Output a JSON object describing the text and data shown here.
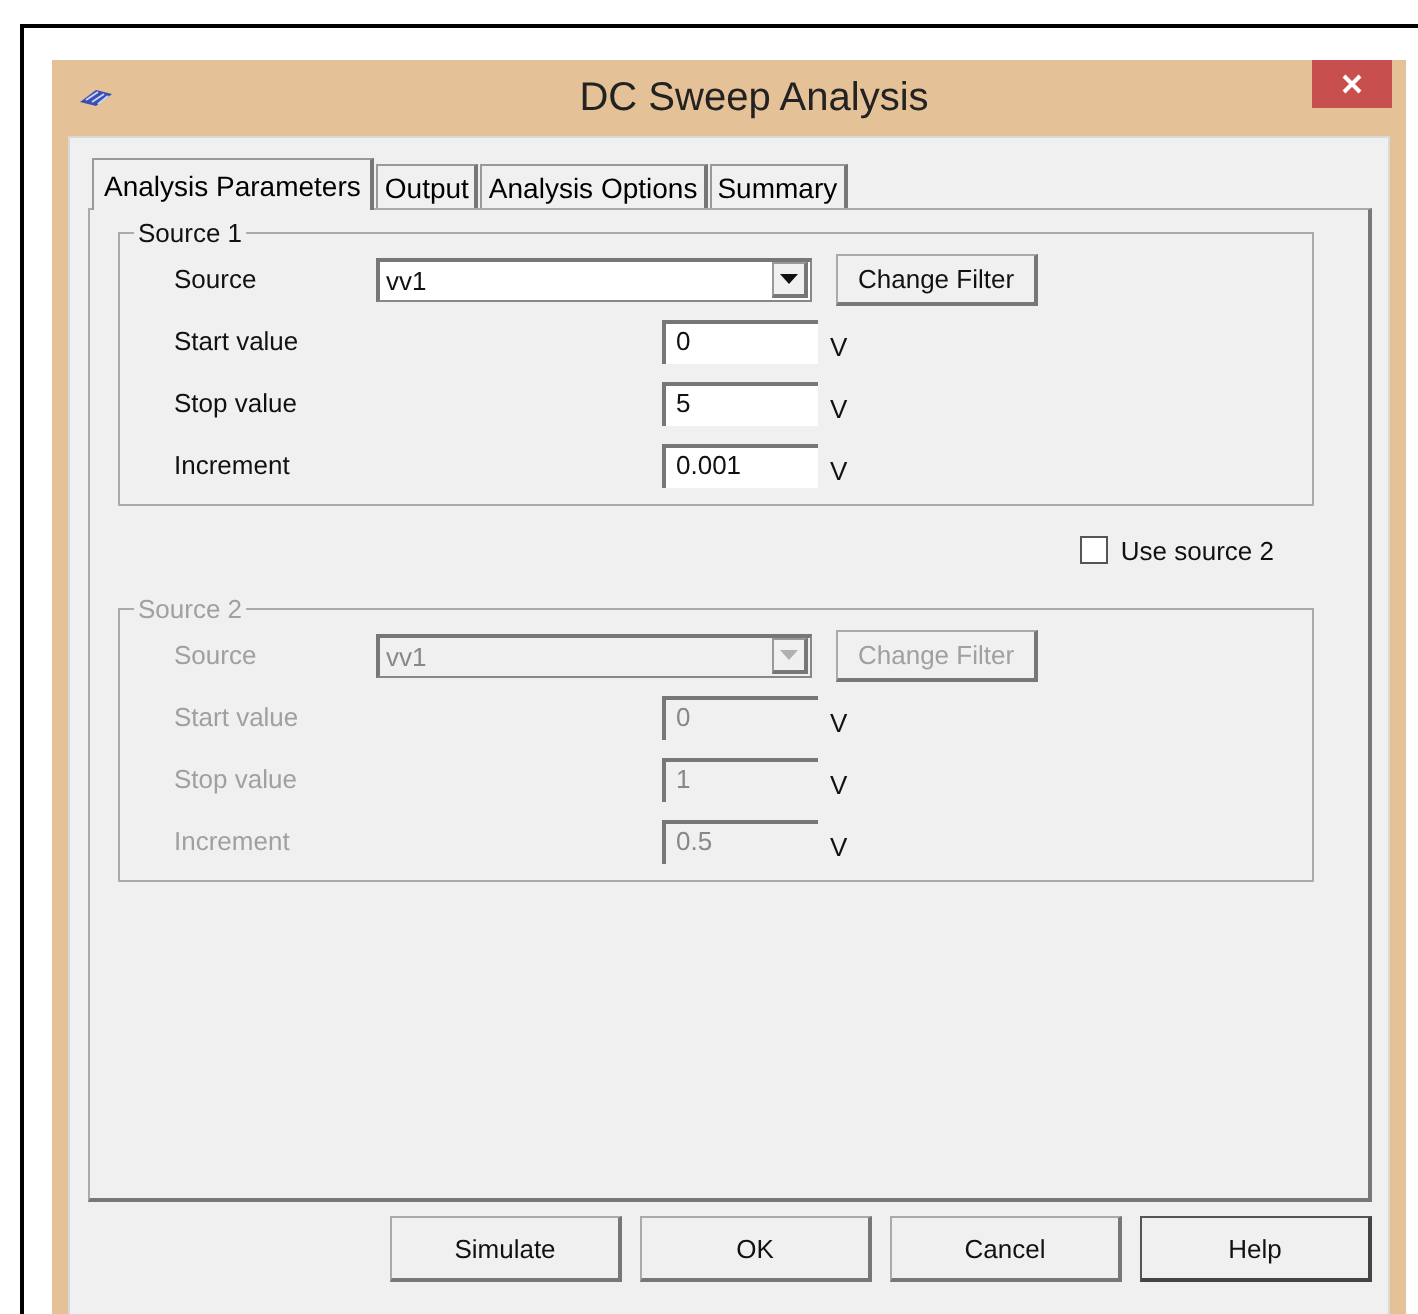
{
  "window": {
    "title": "DC Sweep Analysis"
  },
  "tabs": [
    {
      "label": "Analysis Parameters",
      "selected": true
    },
    {
      "label": "Output",
      "selected": false
    },
    {
      "label": "Analysis Options",
      "selected": false
    },
    {
      "label": "Summary",
      "selected": false
    }
  ],
  "sources": [
    {
      "title": "Source 1",
      "disabled": false,
      "source_label": "Source",
      "source_value": "vv1",
      "filter_button": "Change Filter",
      "fields": [
        {
          "label": "Start value",
          "value": "0",
          "unit": "V"
        },
        {
          "label": "Stop value",
          "value": "5",
          "unit": "V"
        },
        {
          "label": "Increment",
          "value": "0.001",
          "unit": "V"
        }
      ]
    },
    {
      "title": "Source 2",
      "disabled": true,
      "source_label": "Source",
      "source_value": "vv1",
      "filter_button": "Change Filter",
      "fields": [
        {
          "label": "Start value",
          "value": "0",
          "unit": "V"
        },
        {
          "label": "Stop value",
          "value": "1",
          "unit": "V"
        },
        {
          "label": "Increment",
          "value": "0.5",
          "unit": "V"
        }
      ]
    }
  ],
  "use_source_2": {
    "label": "Use source 2",
    "checked": false
  },
  "buttons": [
    {
      "label": "Simulate",
      "default": false
    },
    {
      "label": "OK",
      "default": false
    },
    {
      "label": "Cancel",
      "default": false
    },
    {
      "label": "Help",
      "default": true
    }
  ]
}
